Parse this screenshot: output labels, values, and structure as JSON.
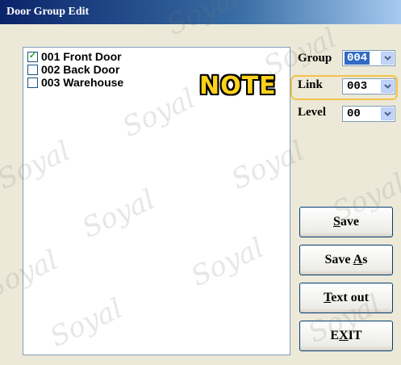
{
  "window": {
    "title": "Door Group Edit"
  },
  "door_list": {
    "items": [
      {
        "label": "001 Front Door",
        "checked": true
      },
      {
        "label": "002 Back Door",
        "checked": false
      },
      {
        "label": "003 Warehouse",
        "checked": false
      }
    ]
  },
  "fields": {
    "group": {
      "label": "Group",
      "value": "004"
    },
    "link": {
      "label": "Link",
      "value": "003"
    },
    "level": {
      "label": "Level",
      "value": "00"
    }
  },
  "annotation": {
    "text": "NOTE",
    "color": "#ffd11a",
    "highlight_color": "#f2c24a"
  },
  "buttons": {
    "save": {
      "pre": "",
      "key": "S",
      "post": "ave"
    },
    "save_as": {
      "pre": "Save ",
      "key": "A",
      "post": "s"
    },
    "text_out": {
      "pre": "",
      "key": "T",
      "post": "ext out"
    },
    "exit": {
      "pre": "E",
      "key": "X",
      "post": "IT"
    }
  },
  "watermark": {
    "text": "Soyal"
  },
  "colors": {
    "title_bar": "#0a246a",
    "dialog_bg": "#ece9d8",
    "selection": "#316ac5"
  }
}
